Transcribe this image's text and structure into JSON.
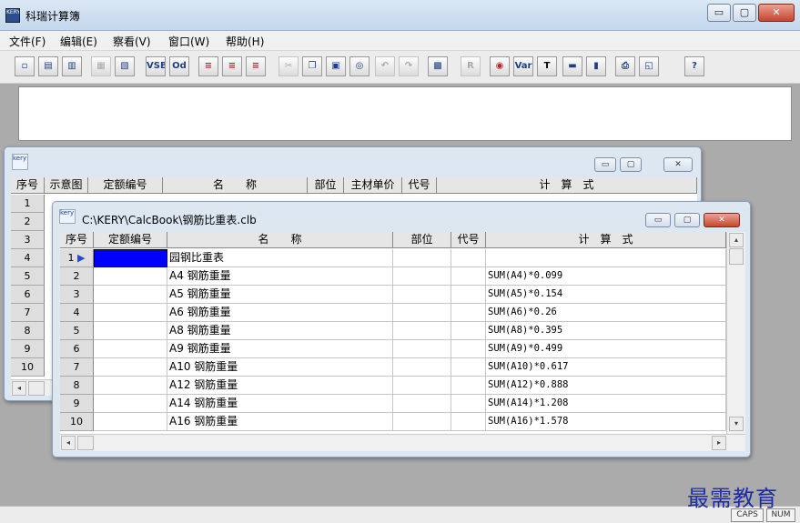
{
  "app": {
    "title": "科瑞计算簿",
    "icon_text": "KERY"
  },
  "window_controls": {
    "minimize": "▭",
    "maximize": "▢",
    "close": "✕"
  },
  "menu": [
    "文件(F)",
    "编辑(E)",
    "察看(V)",
    "窗口(W)",
    "帮助(H)"
  ],
  "toolbar_labels": {
    "vsb": "VSB",
    "od": "Od",
    "r": "R",
    "var": "Var",
    "t": "T",
    "help": "?"
  },
  "back_window": {
    "icon_text": "kery",
    "headers": [
      "序号",
      "示意图",
      "定额编号",
      "名　　称",
      "部位",
      "主材单价",
      "代号",
      "计　算　式"
    ],
    "row_numbers": [
      "1",
      "2",
      "3",
      "4",
      "5",
      "6",
      "7",
      "8",
      "9",
      "10"
    ]
  },
  "front_window": {
    "icon_text": "kery",
    "title": "C:\\KERY\\CalcBook\\钢筋比重表.clb",
    "headers": [
      "序号",
      "定额编号",
      "名　　称",
      "部位",
      "代号",
      "计　算　式"
    ],
    "rows": [
      {
        "no": "1",
        "code": "",
        "name": "园钢比重表",
        "formula": ""
      },
      {
        "no": "2",
        "code": "",
        "name": "A4 钢筋重量",
        "formula": "SUM(A4)*0.099"
      },
      {
        "no": "3",
        "code": "",
        "name": "A5 钢筋重量",
        "formula": "SUM(A5)*0.154"
      },
      {
        "no": "4",
        "code": "",
        "name": "A6 钢筋重量",
        "formula": "SUM(A6)*0.26"
      },
      {
        "no": "5",
        "code": "",
        "name": "A8 钢筋重量",
        "formula": "SUM(A8)*0.395"
      },
      {
        "no": "6",
        "code": "",
        "name": "A9 钢筋重量",
        "formula": "SUM(A9)*0.499"
      },
      {
        "no": "7",
        "code": "",
        "name": "A10 钢筋重量",
        "formula": "SUM(A10)*0.617"
      },
      {
        "no": "8",
        "code": "",
        "name": "A12 钢筋重量",
        "formula": "SUM(A12)*0.888"
      },
      {
        "no": "9",
        "code": "",
        "name": "A14 钢筋重量",
        "formula": "SUM(A14)*1.208"
      },
      {
        "no": "10",
        "code": "",
        "name": "A16 钢筋重量",
        "formula": "SUM(A16)*1.578"
      }
    ]
  },
  "status": {
    "caps": "CAPS",
    "num": "NUM"
  },
  "watermark": "最需教育",
  "colors": {
    "selected_cell": "#0000ff",
    "titlebar": "#c4d7ec"
  }
}
